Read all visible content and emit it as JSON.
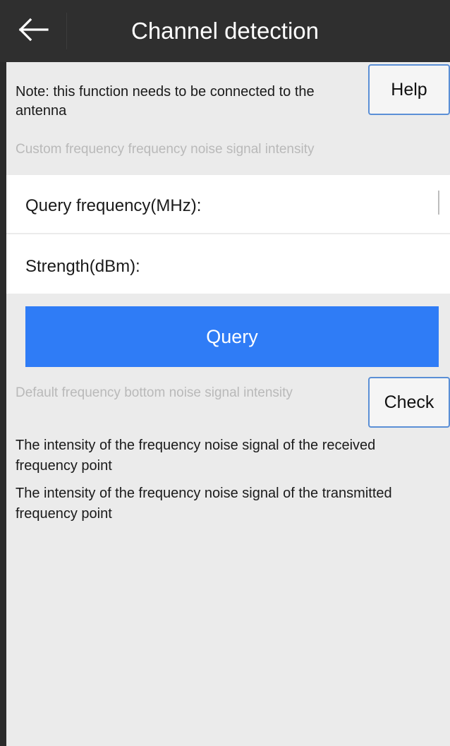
{
  "header": {
    "title": "Channel detection",
    "back_icon": "arrow-left-icon"
  },
  "note": {
    "text": "Note: this function needs to be connected to the antenna"
  },
  "help_button": {
    "label": "Help"
  },
  "custom_hint": "Custom frequency frequency noise signal intensity",
  "form": {
    "query_frequency_label": "Query frequency(MHz):",
    "query_frequency_value": "",
    "strength_label": "Strength(dBm):",
    "strength_value": ""
  },
  "query_button": {
    "label": "Query",
    "color": "#2f7cf6"
  },
  "default_hint": "Default frequency bottom noise signal intensity",
  "check_button": {
    "label": "Check"
  },
  "info": {
    "received": "The intensity of the frequency noise signal of the received frequency point",
    "transmitted": "The intensity of the frequency noise signal of the transmitted frequency point"
  },
  "colors": {
    "header_bg": "#2f2f2f",
    "content_bg": "#ebebeb",
    "accent": "#2f7cf6",
    "button_border": "#5b8fd6",
    "hint_text": "#b9b9b9"
  }
}
